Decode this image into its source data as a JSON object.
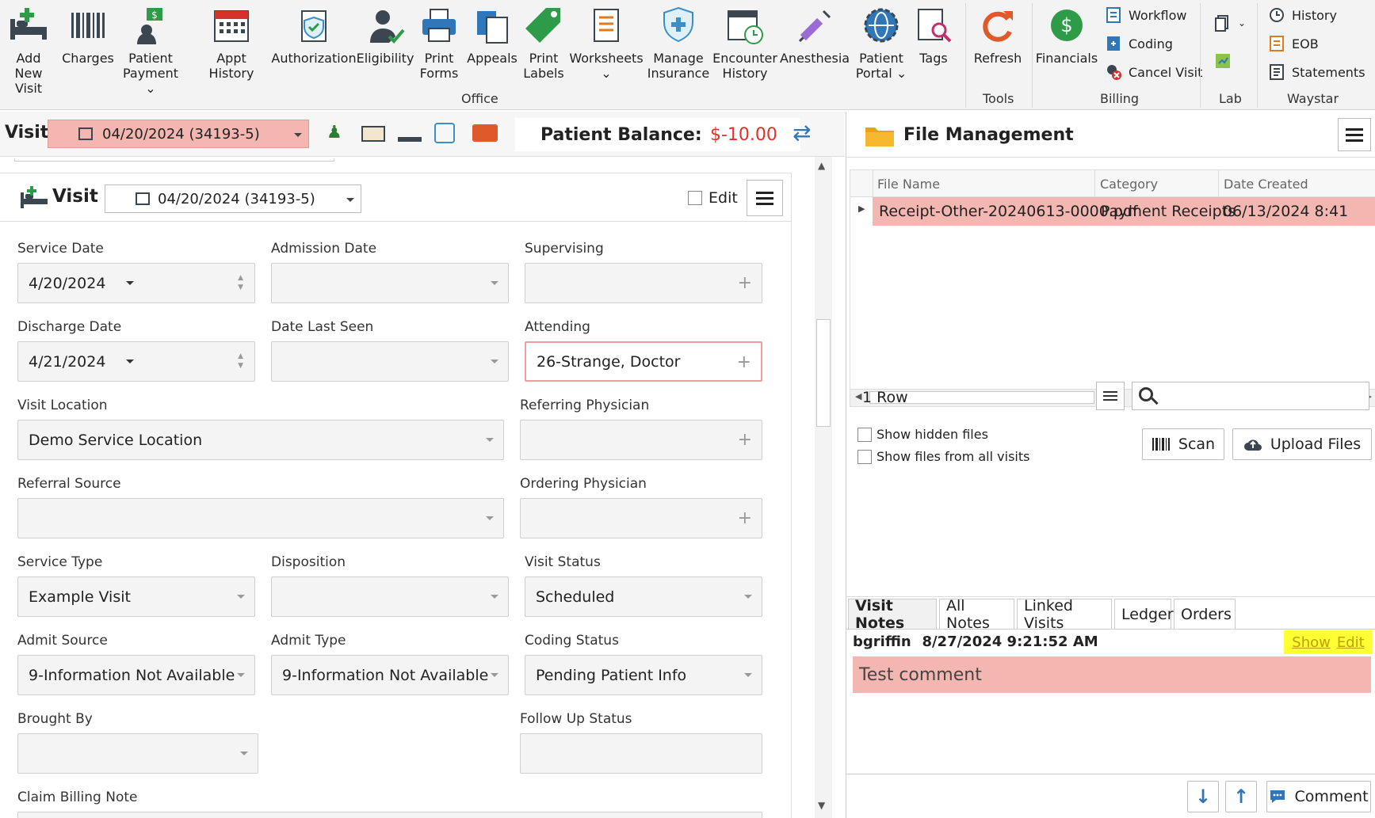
{
  "ribbon": {
    "buttons": [
      {
        "label1": "Add New",
        "label2": "Visit",
        "icon": "add-visit-icon"
      },
      {
        "label1": "Charges",
        "label2": "",
        "icon": "barcode-icon"
      },
      {
        "label1": "Patient",
        "label2": "Payment ⌄",
        "icon": "patient-payment-icon"
      },
      {
        "label1": "Appt History",
        "label2": "",
        "icon": "calendar-icon"
      },
      {
        "label1": "Authorization",
        "label2": "",
        "icon": "shield-check-icon"
      },
      {
        "label1": "Eligibility",
        "label2": "",
        "icon": "person-check-icon"
      },
      {
        "label1": "Print",
        "label2": "Forms",
        "icon": "printer-icon"
      },
      {
        "label1": "Appeals",
        "label2": "",
        "icon": "documents-icon"
      },
      {
        "label1": "Print",
        "label2": "Labels",
        "icon": "tag-icon"
      },
      {
        "label1": "Worksheets",
        "label2": "⌄",
        "icon": "worksheet-icon"
      },
      {
        "label1": "Manage",
        "label2": "Insurance",
        "icon": "insurance-shield-icon"
      },
      {
        "label1": "Encounter",
        "label2": "History",
        "icon": "calendar-clock-icon"
      },
      {
        "label1": "Anesthesia",
        "label2": "",
        "icon": "syringe-icon"
      },
      {
        "label1": "Patient",
        "label2": "Portal ⌄",
        "icon": "globe-gear-icon"
      },
      {
        "label1": "Tags",
        "label2": "",
        "icon": "tag-search-icon"
      },
      {
        "label1": "Refresh",
        "label2": "",
        "icon": "refresh-icon"
      },
      {
        "label1": "Financials",
        "label2": "",
        "icon": "dollar-icon"
      }
    ],
    "billing_items": [
      "Workflow",
      "Coding",
      "Cancel Visit"
    ],
    "waystar_items": [
      "History",
      "EOB",
      "Statements"
    ],
    "groups": {
      "office": "Office",
      "tools": "Tools",
      "billing": "Billing",
      "lab": "Lab",
      "waystar": "Waystar"
    }
  },
  "visitbar": {
    "label": "Visit",
    "selected": "04/20/2024 (34193-5)",
    "balance_label": "Patient Balance:",
    "balance_value": "$-10.00"
  },
  "visit_panel": {
    "title": "Visit",
    "selected": "04/20/2024 (34193-5)",
    "edit_label": "Edit",
    "fields": {
      "service_date": {
        "label": "Service Date",
        "value": "4/20/2024"
      },
      "admission_date": {
        "label": "Admission Date",
        "value": ""
      },
      "supervising": {
        "label": "Supervising",
        "value": ""
      },
      "discharge_date": {
        "label": "Discharge Date",
        "value": "4/21/2024"
      },
      "date_last_seen": {
        "label": "Date Last Seen",
        "value": ""
      },
      "attending": {
        "label": "Attending",
        "value": "26-Strange, Doctor"
      },
      "visit_location": {
        "label": "Visit Location",
        "value": "Demo Service Location"
      },
      "referring_physician": {
        "label": "Referring Physician",
        "value": ""
      },
      "referral_source": {
        "label": "Referral Source",
        "value": ""
      },
      "ordering_physician": {
        "label": "Ordering Physician",
        "value": ""
      },
      "service_type": {
        "label": "Service Type",
        "value": "Example Visit"
      },
      "disposition": {
        "label": "Disposition",
        "value": ""
      },
      "visit_status": {
        "label": "Visit Status",
        "value": "Scheduled"
      },
      "admit_source": {
        "label": "Admit Source",
        "value": "9-Information Not Available"
      },
      "admit_type": {
        "label": "Admit Type",
        "value": "9-Information Not Available"
      },
      "coding_status": {
        "label": "Coding Status",
        "value": "Pending Patient Info"
      },
      "brought_by": {
        "label": "Brought By",
        "value": ""
      },
      "follow_up_status": {
        "label": "Follow Up Status",
        "value": ""
      },
      "claim_billing_note": {
        "label": "Claim Billing Note",
        "value": ""
      }
    }
  },
  "file_management": {
    "title": "File Management",
    "columns": [
      "File Name",
      "Category",
      "Date Created"
    ],
    "rows": [
      {
        "name": "Receipt-Other-20240613-0000.pdf",
        "category": "Payment Receipts",
        "date": "06/13/2024 8:41"
      }
    ],
    "row_count": "1 Row",
    "show_hidden": "Show hidden files",
    "show_all": "Show files from all visits",
    "scan": "Scan",
    "upload": "Upload Files"
  },
  "notes": {
    "tabs": [
      "Visit Notes",
      "All Notes",
      "Linked Visits",
      "Ledger",
      "Orders"
    ],
    "author": "bgriffin",
    "timestamp": "8/27/2024 9:21:52 AM",
    "show": "Show",
    "edit": "Edit",
    "comment_text": "Test comment",
    "comment_button": "Comment"
  },
  "colors": {
    "accent_pink": "#f4b6b1",
    "balance_red": "#e0322b",
    "highlight_yellow": "#ffff33"
  }
}
